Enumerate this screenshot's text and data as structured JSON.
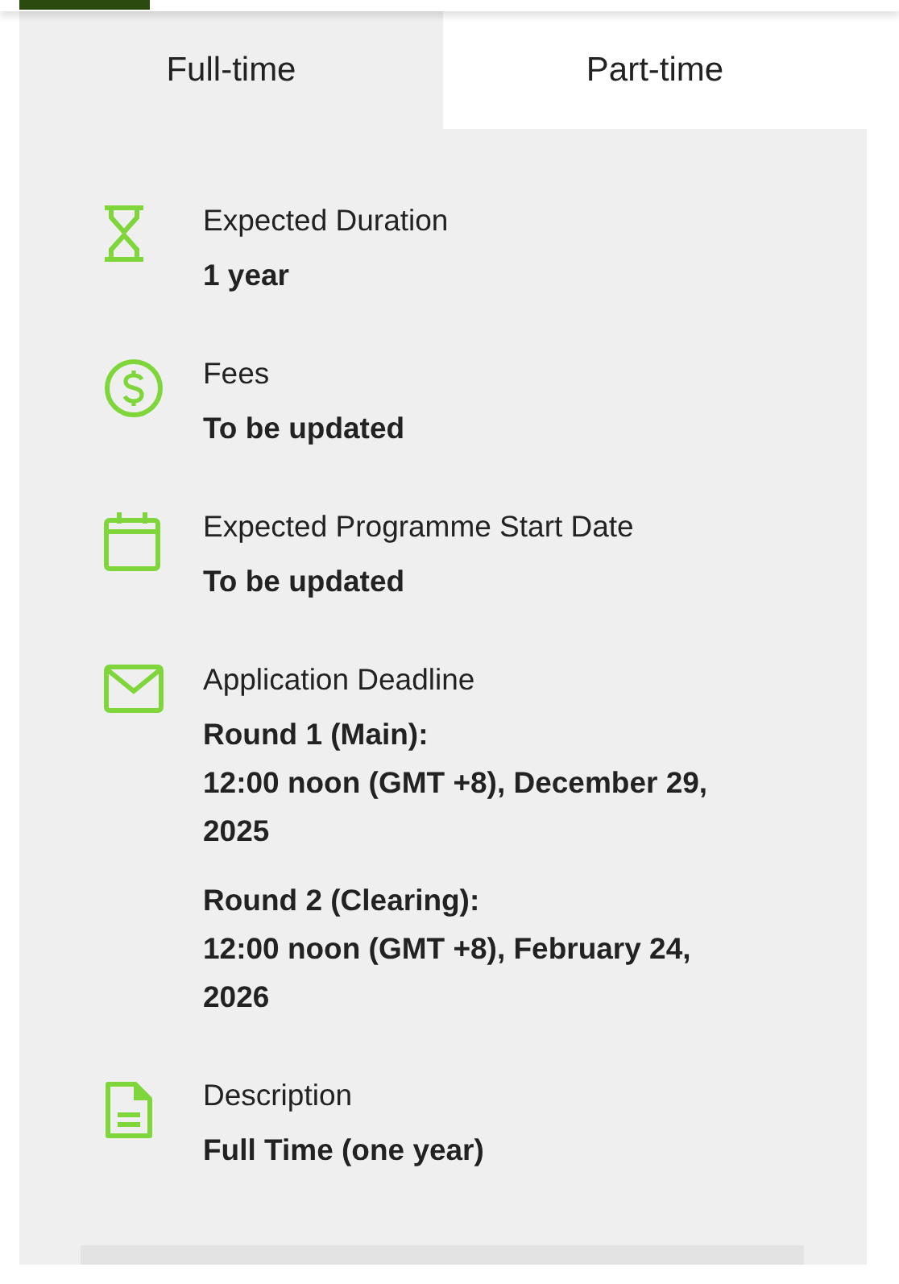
{
  "tabs": [
    {
      "label": "Full-time",
      "selected": true
    },
    {
      "label": "Part-time",
      "selected": false
    }
  ],
  "details": [
    {
      "label": "Expected Duration",
      "values": [
        [
          "1 year"
        ]
      ]
    },
    {
      "label": "Fees",
      "values": [
        [
          "To be updated"
        ]
      ]
    },
    {
      "label": "Expected Programme Start Date",
      "values": [
        [
          "To be updated"
        ]
      ]
    },
    {
      "label": "Application Deadline",
      "values": [
        [
          "Round 1 (Main):",
          "12:00 noon (GMT +8), December 29, 2025"
        ],
        [
          "Round 2 (Clearing):",
          "12:00 noon (GMT +8), February 24, 2026"
        ]
      ]
    },
    {
      "label": "Description",
      "values": [
        [
          "Full Time (one year)"
        ]
      ]
    }
  ]
}
